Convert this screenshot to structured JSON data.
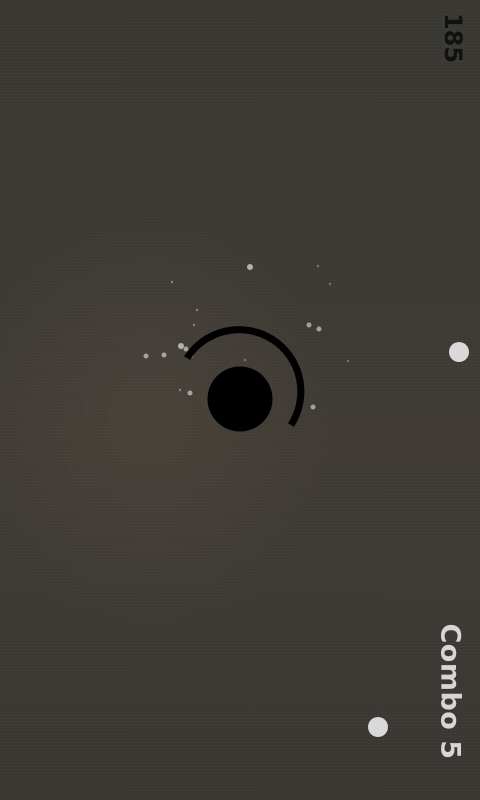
{
  "hud": {
    "score": "185",
    "combo": "Combo 5"
  },
  "colors": {
    "background": "#3c3934",
    "player": "#000000",
    "ring": "#000000",
    "target_dot": "#d9d9d9",
    "particles": "#cfcfcf",
    "score_text": "#111111",
    "combo_text": "#d6d6d6"
  }
}
